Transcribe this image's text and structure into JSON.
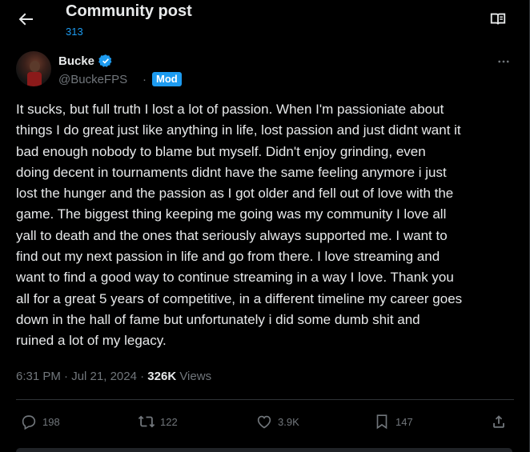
{
  "header": {
    "title": "Community post",
    "subtitle": "313"
  },
  "author": {
    "name": "Bucke",
    "handle": "@BuckeFPS",
    "separator": "·",
    "badge": "Mod"
  },
  "post": {
    "text": "It sucks, but full truth I lost a lot of passion. When I'm passioniate about\nthings I do great just like anything in life, lost passion and just didnt want it\nbad enough nobody to blame but myself. Didn't enjoy grinding, even\ndoing decent in tournaments didnt have the same feeling anymore i just\nlost the hunger and the passion as I got older and fell out of love with the\ngame. The biggest thing keeping me going was my community I love all\nyall to death and the ones that seriously always supported me. I want to\nfind out my next passion in life and go from there. I love streaming and\nwant to find a good way to continue streaming in a way I love. Thank you\nall for a great 5 years of competitive, in a different timeline my career goes\ndown in the hall of fame but unfortunately i did some dumb shit and\nruined a lot of my legacy."
  },
  "meta": {
    "time": "6:31 PM",
    "separator": " · ",
    "date": "Jul 21, 2024",
    "sep2": " · ",
    "views_count": "326K",
    "views_label": " Views"
  },
  "actions": {
    "replies": "198",
    "reposts": "122",
    "likes": "3.9K",
    "bookmarks": "147"
  },
  "icons": {
    "back": "arrow-left-icon",
    "reader": "book-open-icon",
    "verified": "verified-badge-icon",
    "more": "more-horizontal-icon",
    "reply": "reply-icon",
    "repost": "repost-icon",
    "like": "heart-icon",
    "bookmark": "bookmark-icon",
    "share": "share-icon"
  },
  "colors": {
    "accent": "#1d9bf0",
    "text": "#e7e9ea",
    "muted": "#71767b",
    "background": "#000000",
    "border": "#2f3336"
  }
}
